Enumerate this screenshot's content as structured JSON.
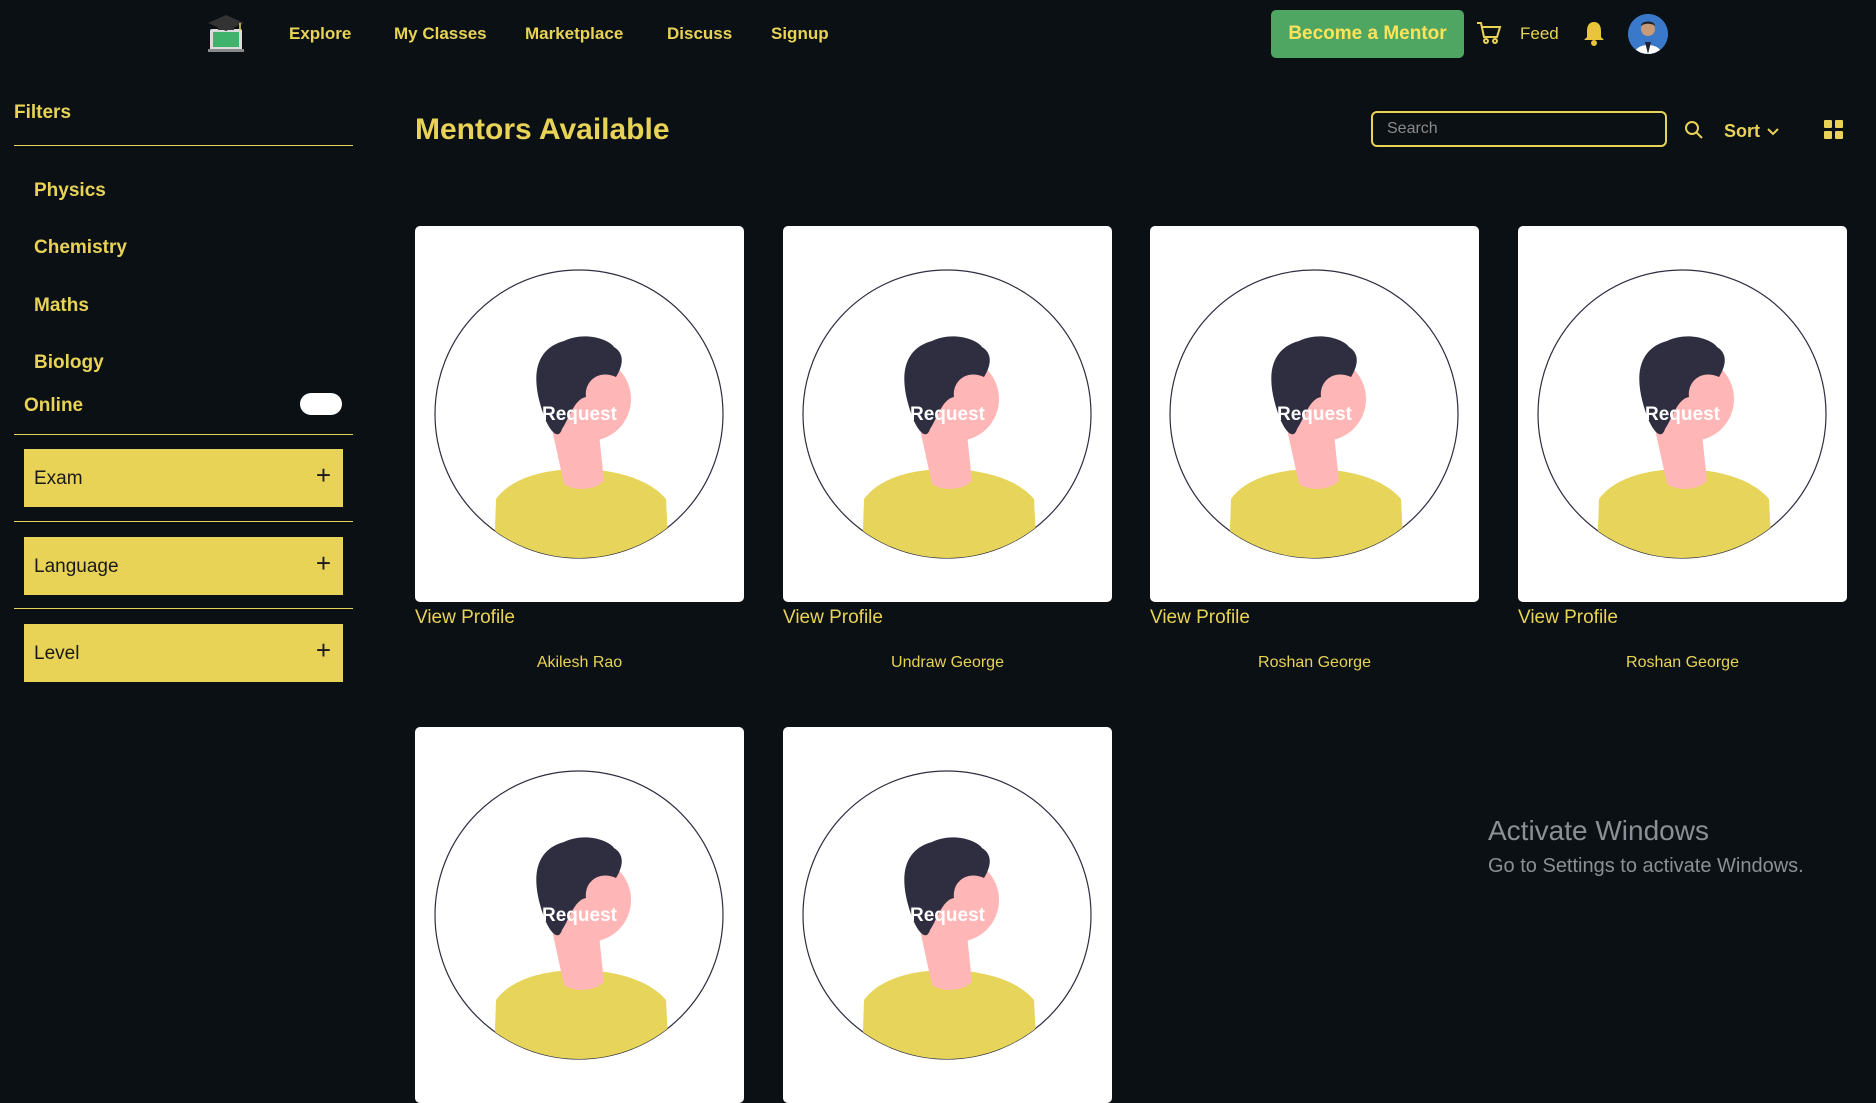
{
  "nav": {
    "links": [
      "Explore",
      "My Classes",
      "Marketplace",
      "Discuss",
      "Signup"
    ],
    "become_mentor": "Become a Mentor",
    "feed": "Feed"
  },
  "sidebar": {
    "title": "Filters",
    "subjects": [
      "Physics",
      "Chemistry",
      "Maths",
      "Biology"
    ],
    "online_label": "Online",
    "accordions": [
      "Exam",
      "Language",
      "Level"
    ],
    "accordion_icon": "+"
  },
  "main": {
    "title": "Mentors Available",
    "search_placeholder": "Search",
    "sort_label": "Sort",
    "request_label": "Request",
    "view_profile_label": "View Profile",
    "mentors": [
      {
        "name": "Akilesh Rao"
      },
      {
        "name": "Undraw George"
      },
      {
        "name": "Roshan George"
      },
      {
        "name": "Roshan George"
      },
      {
        "name": ""
      },
      {
        "name": ""
      }
    ]
  },
  "watermark": {
    "title": "Activate Windows",
    "subtitle": "Go to Settings to activate Windows."
  },
  "colors": {
    "background": "#0a1014",
    "accent": "#e8d356",
    "button_green": "#4fa562",
    "card": "#ffffff"
  },
  "icons": [
    "logo-icon",
    "cart-icon",
    "bell-icon",
    "avatar",
    "search-icon",
    "chevron-down-icon",
    "grid-view-icon",
    "plus-icon"
  ]
}
